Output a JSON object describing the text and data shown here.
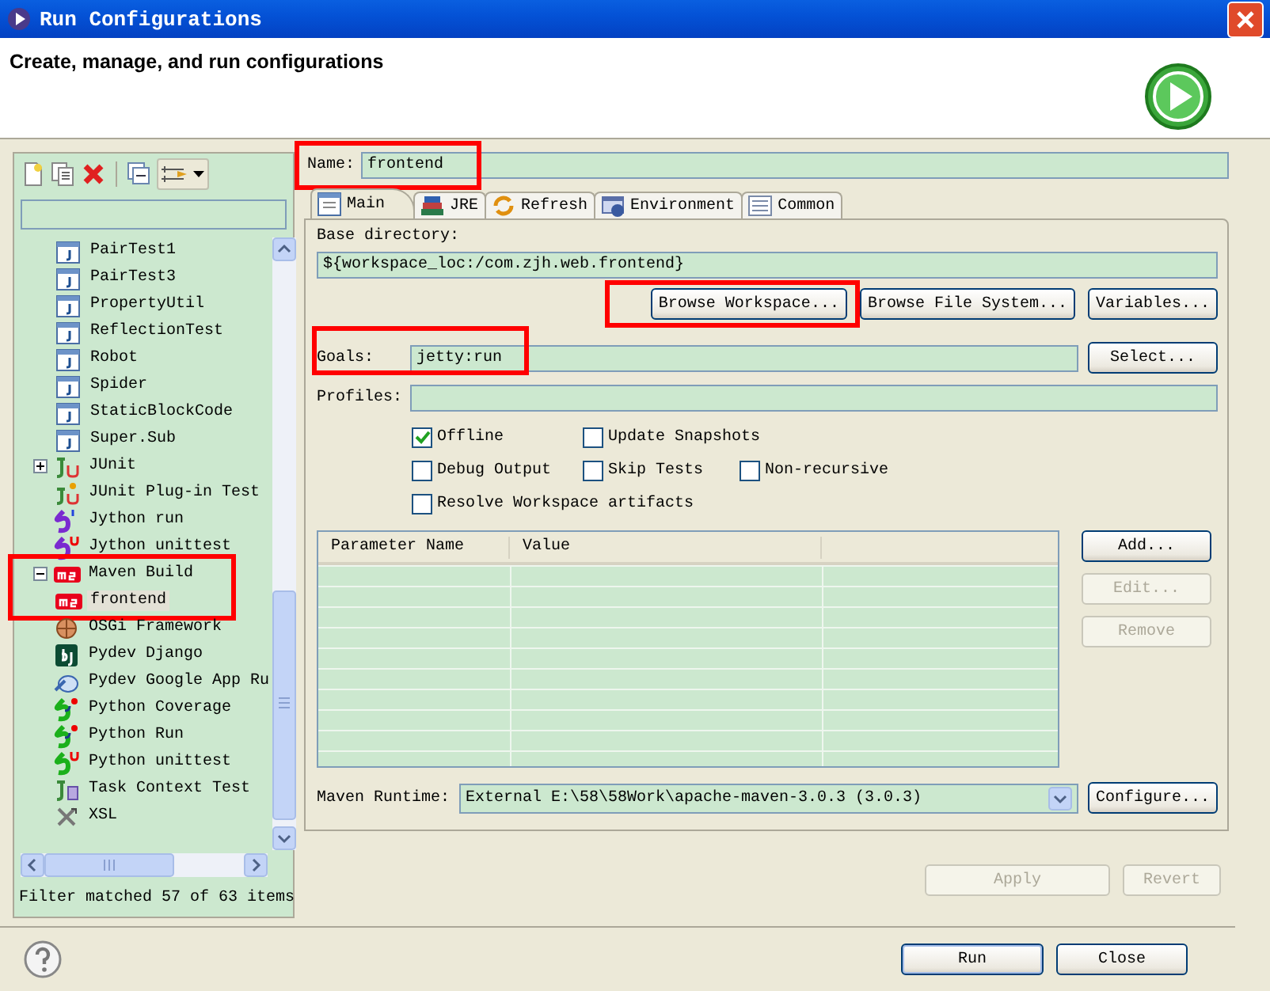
{
  "window": {
    "title": "Run Configurations"
  },
  "header": {
    "title": "Create, manage, and run configurations"
  },
  "sidebar": {
    "tree": {
      "continued_children": [
        {
          "label": "PairTest1",
          "kind": "java-class"
        },
        {
          "label": "PairTest3",
          "kind": "java-class"
        },
        {
          "label": "PropertyUtil",
          "kind": "java-class"
        },
        {
          "label": "ReflectionTest",
          "kind": "java-class"
        },
        {
          "label": "Robot",
          "kind": "java-class"
        },
        {
          "label": "Spider",
          "kind": "java-class"
        },
        {
          "label": "StaticBlockCode",
          "kind": "java-class"
        },
        {
          "label": "Super.Sub",
          "kind": "java-class"
        }
      ],
      "items": [
        {
          "label": "JUnit",
          "kind": "junit",
          "expanded": false,
          "highlighted": false
        },
        {
          "label": "JUnit Plug-in Test",
          "kind": "junit-plugin",
          "highlighted": false
        },
        {
          "label": "Jython run",
          "kind": "jython",
          "highlighted": false
        },
        {
          "label": "Jython unittest",
          "kind": "jython-test",
          "highlighted": false
        },
        {
          "label": "Maven Build",
          "kind": "maven",
          "expanded": true,
          "highlighted": true,
          "children": [
            {
              "label": "frontend",
              "kind": "maven",
              "selected": true
            }
          ]
        },
        {
          "label": "OSGi Framework",
          "kind": "osgi",
          "highlighted": false
        },
        {
          "label": "Pydev Django",
          "kind": "django",
          "highlighted": false
        },
        {
          "label": "Pydev Google App Ru",
          "kind": "google-app",
          "highlighted": false
        },
        {
          "label": "Python Coverage",
          "kind": "python",
          "highlighted": false
        },
        {
          "label": "Python Run",
          "kind": "python",
          "highlighted": false
        },
        {
          "label": "Python unittest",
          "kind": "python-test",
          "highlighted": false
        },
        {
          "label": "Task Context Test",
          "kind": "task-context",
          "highlighted": false
        },
        {
          "label": "XSL",
          "kind": "xsl",
          "highlighted": false
        }
      ]
    },
    "status": "Filter matched 57 of 63 items"
  },
  "editor": {
    "name": {
      "label": "Name:",
      "value": "frontend",
      "highlighted": true
    },
    "tabs": [
      {
        "label": "Main",
        "selected": true
      },
      {
        "label": "JRE",
        "selected": false
      },
      {
        "label": "Refresh",
        "selected": false
      },
      {
        "label": "Environment",
        "selected": false
      },
      {
        "label": "Common",
        "selected": false
      }
    ],
    "base_directory": {
      "label": "Base directory:",
      "value": "${workspace_loc:/com.zjh.web.frontend}"
    },
    "directory_buttons": [
      {
        "label": "Browse Workspace...",
        "highlighted": true
      },
      {
        "label": "Browse File System...",
        "highlighted": false
      },
      {
        "label": "Variables...",
        "highlighted": false
      }
    ],
    "goals": {
      "label": "Goals:",
      "value": "jetty:run",
      "highlighted": true,
      "button": "Select..."
    },
    "profiles": {
      "label": "Profiles:"
    },
    "options": [
      [
        {
          "label": "Offline",
          "checked": true
        },
        {
          "label": "Update Snapshots",
          "checked": false
        }
      ],
      [
        {
          "label": "Debug Output",
          "checked": false
        },
        {
          "label": "Skip Tests",
          "checked": false
        },
        {
          "label": "Non-recursive",
          "checked": false
        }
      ],
      [
        {
          "label": "Resolve Workspace artifacts",
          "checked": false
        }
      ]
    ],
    "parameters": {
      "columns": [
        "Parameter Name",
        "Value"
      ],
      "buttons": [
        {
          "label": "Add...",
          "disabled": false
        },
        {
          "label": "Edit...",
          "disabled": true
        },
        {
          "label": "Remove",
          "disabled": true
        }
      ]
    },
    "runtime": {
      "label": "Maven Runtime:",
      "value": "External E:\\58\\58Work\\apache-maven-3.0.3 (3.0.3)",
      "button": "Configure..."
    }
  },
  "footer_buttons": [
    {
      "label": "Apply",
      "disabled": true
    },
    {
      "label": "Revert",
      "disabled": true
    }
  ],
  "dialog_buttons": [
    {
      "label": "Run",
      "default": true
    },
    {
      "label": "Close",
      "default": false
    }
  ]
}
